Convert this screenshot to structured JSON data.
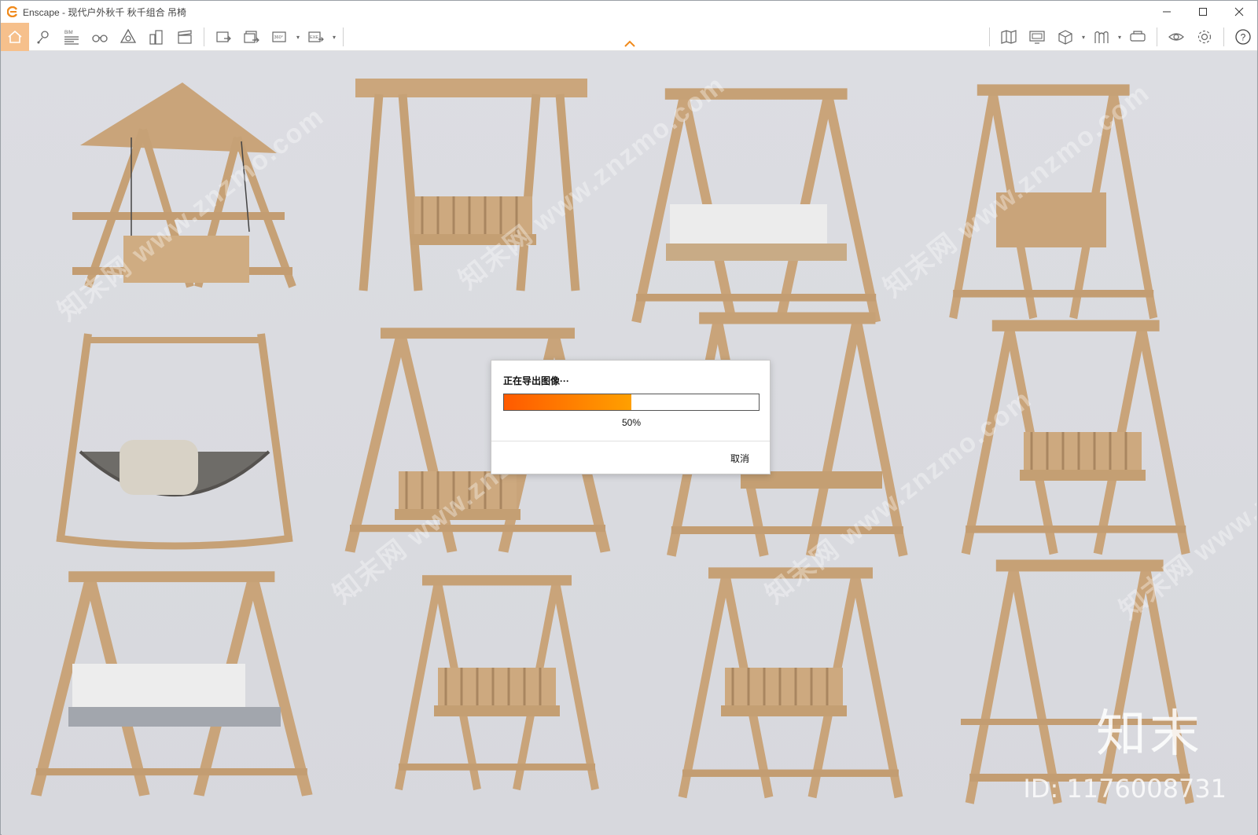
{
  "window": {
    "title": "Enscape - 现代户外秋千 秋千组合 吊椅",
    "brand_color": "#f08a1c",
    "controls": [
      "minimize-icon",
      "maximize-icon",
      "close-icon"
    ]
  },
  "toolbar": {
    "left_tools": [
      {
        "name": "home-icon",
        "active": true
      },
      {
        "name": "marker-icon"
      },
      {
        "name": "bim-icon",
        "label": "BIM"
      },
      {
        "name": "binoculars-icon"
      },
      {
        "name": "visual-settings-icon"
      },
      {
        "name": "buildings-icon"
      },
      {
        "name": "video-clapper-icon"
      },
      {
        "name": "export-image-icon"
      },
      {
        "name": "batch-export-icon"
      },
      {
        "name": "panorama-360-icon",
        "label": "360°"
      },
      {
        "name": "exe-export-icon",
        "label": "EXE"
      }
    ],
    "right_tools": [
      "map-icon",
      "monitor-icon",
      "cube-icon",
      "asset-library-icon",
      "vr-headset-icon",
      "eye-icon",
      "settings-gear-icon",
      "help-icon"
    ],
    "help_label": "?"
  },
  "viewport": {
    "watermark_text": "知末网 www.znzmo.com",
    "brand": "知末",
    "id_text": "ID: 1176008731",
    "wood_color": "#c9a47a",
    "cushion_color": "#f2f2f2"
  },
  "export_dialog": {
    "title": "正在导出图像···",
    "progress": 0.5,
    "progress_label": "50%",
    "cancel_label": "取消",
    "accent_start": "#ff5a00",
    "accent_end": "#ffa000"
  }
}
